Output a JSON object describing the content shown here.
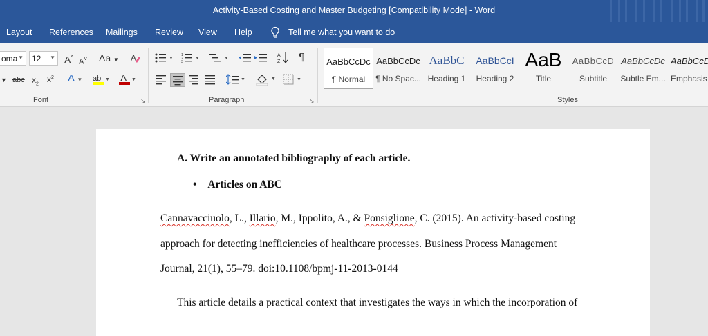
{
  "window": {
    "title": "Activity-Based Costing and Master Budgeting [Compatibility Mode]  -  Word"
  },
  "menu": {
    "items": [
      "Layout",
      "References",
      "Mailings",
      "Review",
      "View",
      "Help"
    ],
    "tell_me": "Tell me what you want to do"
  },
  "ribbon": {
    "font": {
      "name": "oma",
      "size": "12",
      "group_label": "Font"
    },
    "paragraph": {
      "group_label": "Paragraph"
    },
    "styles": {
      "group_label": "Styles",
      "items": [
        {
          "preview": "AaBbCcDc",
          "name": "¶ Normal"
        },
        {
          "preview": "AaBbCcDc",
          "name": "¶ No Spac..."
        },
        {
          "preview": "AaBbC",
          "name": "Heading 1"
        },
        {
          "preview": "AaBbCcI",
          "name": "Heading 2"
        },
        {
          "preview": "AaB",
          "name": "Title"
        },
        {
          "preview": "AaBbCcD",
          "name": "Subtitle"
        },
        {
          "preview": "AaBbCcDc",
          "name": "Subtle Em..."
        },
        {
          "preview": "AaBbCcDc",
          "name": "Emphasis"
        }
      ],
      "colors": {
        "heading": "#2f5496",
        "title": "#000000",
        "subtitle": "#595959"
      }
    }
  },
  "document": {
    "heading_a": "A.  Write an annotated bibliography of each article.",
    "bullet_item": "Articles on ABC",
    "citation": {
      "author1": "Cannavacciuolo",
      "sep1": ", L., ",
      "author2": "Illario",
      "sep2": ", M., Ippolito, A., & ",
      "author3": "Ponsiglione",
      "rest1": ", C. (2015). An activity-based costing",
      "line2": "approach for detecting inefficiencies of healthcare processes. Business Process Management",
      "line3": "Journal, 21(1), 55–79. doi:10.1108/bpmj-11-2013-0144"
    },
    "body": "This article details a practical context that investigates the ways in which the incorporation of"
  },
  "colors": {
    "accent": "#2b579a",
    "font_color_bar": "#c00000",
    "highlight_bar": "#ffff00"
  }
}
